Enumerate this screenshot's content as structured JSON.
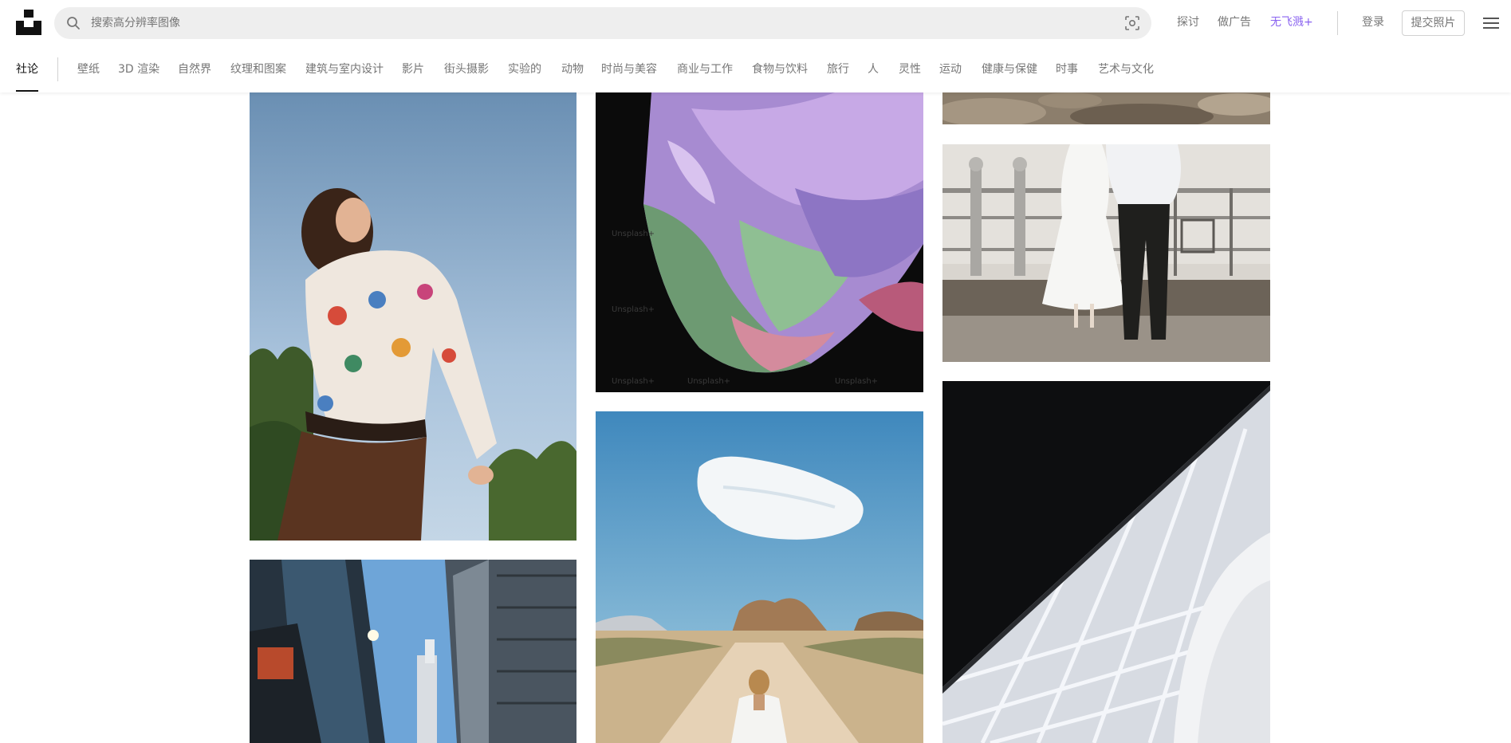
{
  "search": {
    "placeholder": "搜索高分辨率图像"
  },
  "topnav": {
    "explore": "探讨",
    "advertise": "做广告",
    "unsplash_plus": "无飞溅+",
    "login": "登录",
    "submit_photo": "提交照片"
  },
  "categories": [
    "社论",
    "壁纸",
    "3D 渲染",
    "自然界",
    "纹理和图案",
    "建筑与室内设计",
    "影片",
    "街头摄影",
    "实验的",
    "动物",
    "时尚与美容",
    "商业与工作",
    "食物与饮料",
    "旅行",
    "人",
    "灵性",
    "运动",
    "健康与保健",
    "时事",
    "艺术与文化"
  ],
  "active_category": "社论",
  "watermark": "Unsplash+",
  "colors": {
    "accent_purple": "#8a63f0",
    "muted_text": "#767676",
    "primary_text": "#111111",
    "search_bg": "#eeeeee"
  },
  "icons": {
    "logo": "unsplash-logo",
    "search": "search-icon",
    "visual_search": "visual-search-icon",
    "menu": "hamburger-menu-icon"
  },
  "photos": [
    "woman-crochet-sweater",
    "city-skyscrapers",
    "iridescent-fabric",
    "desert-road-cloud",
    "textured-top-partial",
    "wedding-couple-railing",
    "architecture-glass-ceiling"
  ]
}
